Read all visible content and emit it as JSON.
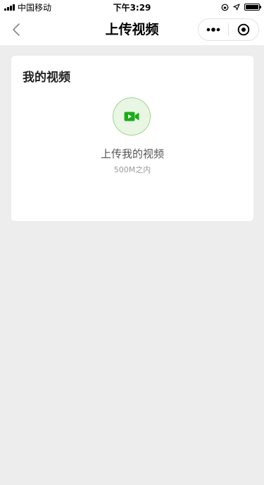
{
  "status_bar": {
    "carrier": "中国移动",
    "time": "下午3:29"
  },
  "nav": {
    "title": "上传视频",
    "back_icon": "chevron-left-icon",
    "menu_icon": "more-dots-icon",
    "close_icon": "target-circle-icon"
  },
  "card": {
    "title": "我的视频",
    "upload_label": "上传我的视频",
    "upload_hint": "500M之内",
    "upload_icon": "video-camera-icon"
  },
  "colors": {
    "accent": "#1aad19",
    "background": "#ededed"
  }
}
